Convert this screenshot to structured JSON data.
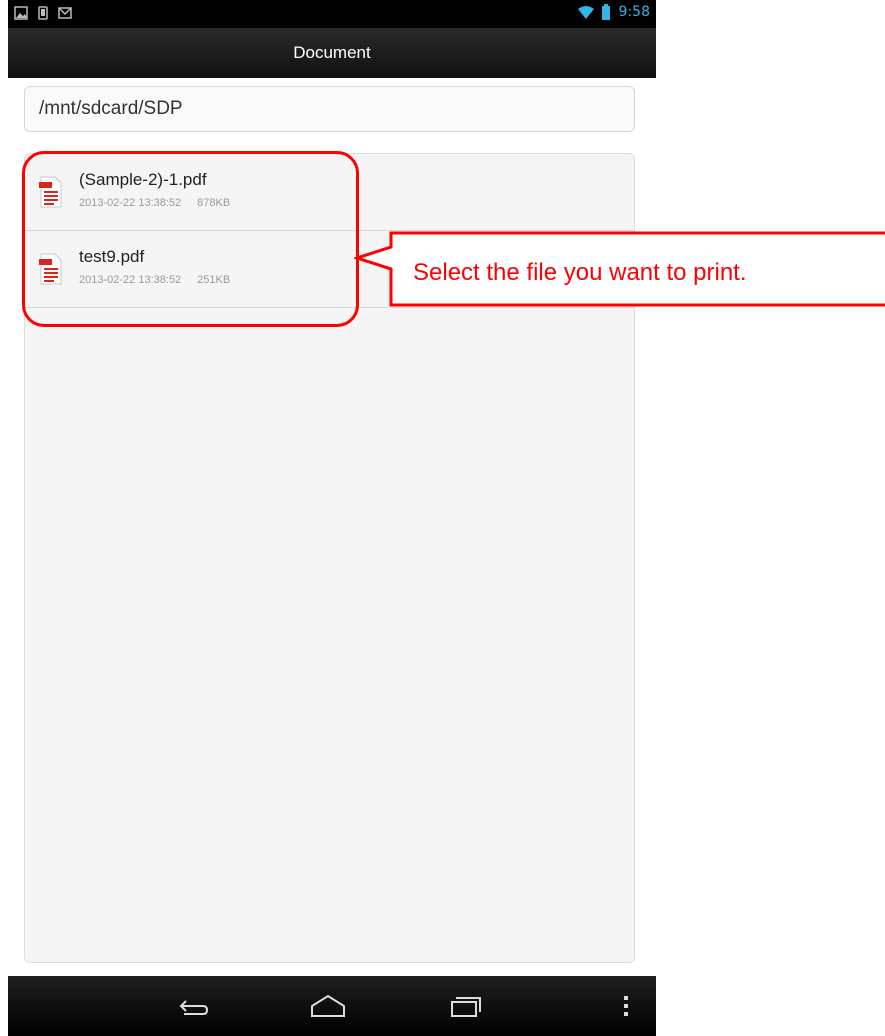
{
  "status_bar": {
    "time": "9:58",
    "left_icons": [
      "image-icon",
      "phone-icon",
      "mail-icon"
    ],
    "right_icons": [
      "wifi-icon",
      "battery-icon"
    ],
    "accent_color": "#33b5e5"
  },
  "title_bar": {
    "title": "Document"
  },
  "path": {
    "value": "/mnt/sdcard/SDP"
  },
  "files": [
    {
      "name": "(Sample-2)-1.pdf",
      "date": "2013-02-22 13:38:52",
      "size": "878KB",
      "icon": "pdf-file-icon"
    },
    {
      "name": "test9.pdf",
      "date": "2013-02-22 13:38:52",
      "size": "251KB",
      "icon": "pdf-file-icon"
    }
  ],
  "nav_bar": {
    "buttons": [
      "back-icon",
      "home-icon",
      "recent-apps-icon",
      "menu-overflow-icon"
    ]
  },
  "annotation": {
    "text": "Select the file you want to print.",
    "color": "#ff0000"
  }
}
